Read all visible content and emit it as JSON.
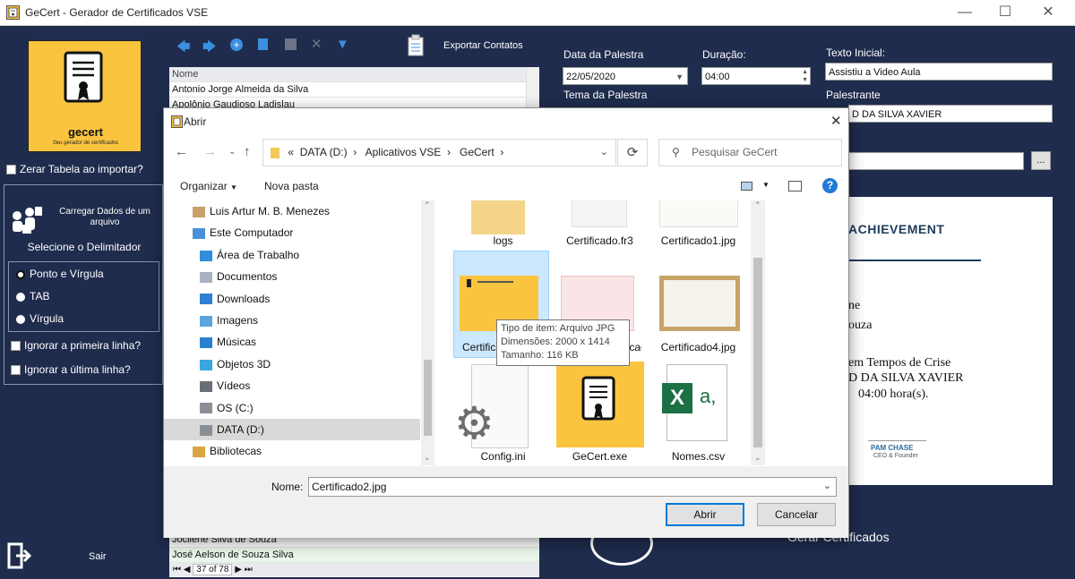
{
  "app": {
    "title": "GeCert - Gerador de Certificados VSE",
    "logo_text": "gecert",
    "logo_tagline": "Seu gerador de certificados"
  },
  "left": {
    "zerar_label": "Zerar Tabela ao importar?",
    "carregar_label": "Carregar Dados de um arquivo",
    "delimiter_title": "Selecione o Delimitador",
    "delimiters": [
      "Ponto e Vírgula",
      "TAB",
      "Vírgula"
    ],
    "ignorar_primeira": "Ignorar a primeira linha?",
    "ignorar_ultima": "Ignorar a última linha?",
    "sair_label": "Sair"
  },
  "middle": {
    "exportar_label": "Exportar Contatos",
    "column_header": "Nome",
    "rows_top": [
      "Antonio Jorge Almeida da Silva",
      "Apolônio Gaudioso Ladislau"
    ],
    "rows_bottom": [
      "Jocilene Silva de Souza",
      "José Aelson de Souza Silva"
    ],
    "nav_record": "37 of 78"
  },
  "right": {
    "data_label": "Data da Palestra",
    "data_value": "22/05/2020",
    "duracao_label": "Duração:",
    "duracao_value": "04:00",
    "texto_label": "Texto Inicial:",
    "texto_value": "Assistiu a Video Aula",
    "tema_label": "Tema da Palestra",
    "palestrante_label": "Palestrante",
    "palestrante_value": "D DA SILVA XAVIER",
    "browse_label": "...",
    "preview_heading": "ACHIEVEMENT",
    "preview_line1": "ne",
    "preview_line2": "ouza",
    "preview_line3": "em Tempos de Crise",
    "preview_line4": "D DA SILVA XAVIER",
    "preview_line5": "04:00 hora(s).",
    "preview_sign_name": "PAM CHASE",
    "preview_sign_role": "CEO & Founder",
    "gerar_label": "Gerar Certificados"
  },
  "dialog": {
    "title": "Abrir",
    "breadcrumb": [
      "«",
      "DATA (D:)",
      "Aplicativos VSE",
      "GeCert"
    ],
    "search_placeholder": "Pesquisar GeCert",
    "organizar_label": "Organizar",
    "nova_pasta_label": "Nova pasta",
    "tree": [
      {
        "label": "Luis Artur M. B. Menezes",
        "icon": "user-icon"
      },
      {
        "label": "Este Computador",
        "icon": "computer-icon"
      },
      {
        "label": "Área de Trabalho",
        "icon": "desktop-icon"
      },
      {
        "label": "Documentos",
        "icon": "documents-icon"
      },
      {
        "label": "Downloads",
        "icon": "download-icon"
      },
      {
        "label": "Imagens",
        "icon": "pictures-icon"
      },
      {
        "label": "Músicas",
        "icon": "music-icon"
      },
      {
        "label": "Objetos 3D",
        "icon": "cube-icon"
      },
      {
        "label": "Vídeos",
        "icon": "video-icon"
      },
      {
        "label": "OS (C:)",
        "icon": "drive-icon"
      },
      {
        "label": "DATA (D:)",
        "icon": "drive-icon"
      },
      {
        "label": "Bibliotecas",
        "icon": "library-icon"
      }
    ],
    "files_row1": [
      "logs",
      "Certificado.fr3",
      "Certificado1.jpg"
    ],
    "files_row2": [
      "Certificado2.jpg",
      "Certificado3.jpg",
      "Certificado4.jpg"
    ],
    "files_row3": [
      "Config.ini",
      "GeCert.exe",
      "Nomes.csv"
    ],
    "tooltip": {
      "line1": "Tipo de item: Arquivo JPG",
      "line2": "Dimensões: 2000 x 1414",
      "line3": "Tamanho: 116 KB"
    },
    "nome_label": "Nome:",
    "nome_value": "Certificado2.jpg",
    "abrir_label": "Abrir",
    "cancelar_label": "Cancelar"
  },
  "colors": {
    "background": "#1f2c4d",
    "logo_yellow": "#fbc43f",
    "selection": "#cce8ff",
    "accent_blue": "#1e7ad6"
  }
}
